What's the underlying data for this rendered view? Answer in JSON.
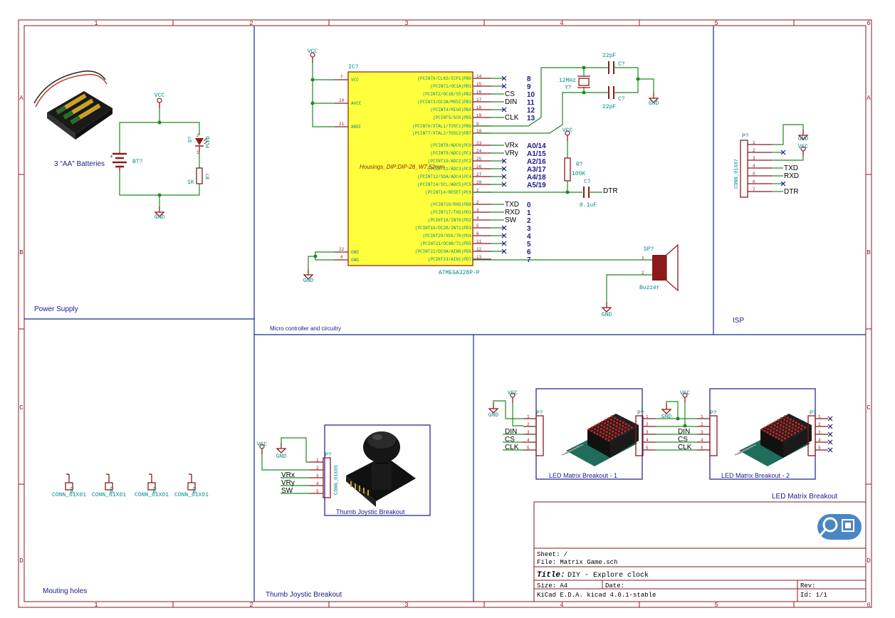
{
  "frame": {
    "cols": [
      "1",
      "2",
      "3",
      "4",
      "5",
      "6"
    ],
    "rows": [
      "A",
      "B",
      "C",
      "D"
    ]
  },
  "power_supply": {
    "title": "Power Supply",
    "battery_label": "3 \"AA\" Batteries",
    "battery_ref": "BT?",
    "vcc": "VCC",
    "gnd": "GND",
    "led_ref": "D?",
    "led_value": "PLED",
    "res_ref": "R?",
    "res_value": "1K",
    "pin1": "1",
    "pin2": "2"
  },
  "mcu": {
    "section_title": "Micro controller and circuitry",
    "ref": "IC?",
    "value": "ATMEGA328P-P",
    "footprint": "Housings_DIP:DIP-28_W7.62mm",
    "vcc": "VCC",
    "gnd": "GND",
    "left_pins": [
      {
        "num": "7",
        "name": "VCC"
      },
      {
        "num": "20",
        "name": "AVCC"
      },
      {
        "num": "21",
        "name": "AREF"
      },
      {
        "num": "22",
        "name": "GND"
      },
      {
        "num": "8",
        "name": "GND"
      }
    ],
    "right_pins": [
      {
        "num": "14",
        "name": "(PCINT0/CLKO/ICP1)PB0",
        "net": "",
        "arduino": "8",
        "nc": true
      },
      {
        "num": "15",
        "name": "(PCINT1/OC1A)PB1",
        "net": "",
        "arduino": "9",
        "nc": true
      },
      {
        "num": "16",
        "name": "(PCINT2/OC1B/SS)PB2",
        "net": "CS",
        "arduino": "10",
        "nc": false
      },
      {
        "num": "17",
        "name": "(PCINT3/OC2A/MOSI)PB3",
        "net": "DIN",
        "arduino": "11",
        "nc": false
      },
      {
        "num": "18",
        "name": "(PCINT4/MISO)PB4",
        "net": "",
        "arduino": "12",
        "nc": true
      },
      {
        "num": "19",
        "name": "(PCINT5/SCK)PB5",
        "net": "CLK",
        "arduino": "13",
        "nc": false
      },
      {
        "num": "9",
        "name": "(PCINT6/XTAL1/TOSC1)PB6",
        "net": "",
        "arduino": "",
        "nc": false
      },
      {
        "num": "10",
        "name": "(PCINT7/XTAL2/TOSC2)PB7",
        "net": "",
        "arduino": "",
        "nc": false
      },
      {
        "num": "23",
        "name": "(PCINT8/ADC0)PC0",
        "net": "VRx",
        "arduino": "A0/14",
        "nc": false
      },
      {
        "num": "24",
        "name": "(PCINT9/ADC1)PC1",
        "net": "VRy",
        "arduino": "A1/15",
        "nc": false
      },
      {
        "num": "25",
        "name": "(PCINT10/ADC2)PC2",
        "net": "",
        "arduino": "A2/16",
        "nc": true
      },
      {
        "num": "26",
        "name": "(PCINT11/ADC3)PC3",
        "net": "",
        "arduino": "A3/17",
        "nc": true
      },
      {
        "num": "27",
        "name": "(PCINT12/SDA/ADC4)PC4",
        "net": "",
        "arduino": "A4/18",
        "nc": true
      },
      {
        "num": "28",
        "name": "(PCINT14/SCL/ADC5)PC5",
        "net": "",
        "arduino": "A5/19",
        "nc": true
      },
      {
        "num": "1",
        "name": "(PCINT14/RESET)PC6",
        "net": "",
        "arduino": "",
        "nc": false
      },
      {
        "num": "2",
        "name": "(PCINT16/RXD)PD0",
        "net": "TXD",
        "arduino": "0",
        "nc": false
      },
      {
        "num": "3",
        "name": "(PCINT17/TXD)PD1",
        "net": "RXD",
        "arduino": "1",
        "nc": false
      },
      {
        "num": "4",
        "name": "(PCINT18/INT0)PD2",
        "net": "SW",
        "arduino": "2",
        "nc": false
      },
      {
        "num": "5",
        "name": "(PCINT19/OC2B/INT1)PD3",
        "net": "",
        "arduino": "3",
        "nc": true
      },
      {
        "num": "6",
        "name": "(PCINT20/XCK/T0)PD4",
        "net": "",
        "arduino": "4",
        "nc": true
      },
      {
        "num": "11",
        "name": "(PCINT21/OC0B/T1)PD5",
        "net": "",
        "arduino": "5",
        "nc": true
      },
      {
        "num": "12",
        "name": "(PCINT22/OC0A/AIN0)PD6",
        "net": "",
        "arduino": "6",
        "nc": true
      },
      {
        "num": "13",
        "name": "(PCINT23/AIN1)PD7",
        "net": "",
        "arduino": "7",
        "nc": false
      }
    ],
    "crystal_value": "12MHz",
    "crystal_ref": "Y?",
    "cap1_value": "22pF",
    "cap1_ref": "C?",
    "cap2_value": "22pF",
    "cap2_ref": "C?",
    "pullup_ref": "R?",
    "pullup_value": "100K",
    "reset_cap_ref": "C?",
    "reset_cap_value": "0.1uF",
    "dtr": "DTR",
    "buzzer_ref": "SP?",
    "buzzer_value": "Buzzer",
    "buzzer_pin1": "1",
    "buzzer_pin2": "2"
  },
  "isp": {
    "title": "ISP",
    "ref": "P?",
    "value": "CONN_01X07",
    "gnd": "GND",
    "vcc": "VCC",
    "pins": [
      "1",
      "2",
      "3",
      "4",
      "5",
      "6",
      "7"
    ],
    "nets": [
      "",
      "",
      "",
      "TXD",
      "RXD",
      "",
      "DTR"
    ]
  },
  "mounting": {
    "title": "Mouting holes",
    "holes": [
      {
        "ref": "P?",
        "value": "CONN_01X01"
      },
      {
        "ref": "P?",
        "value": "CONN_01X01"
      },
      {
        "ref": "P?",
        "value": "CONN_01X01"
      },
      {
        "ref": "P?",
        "value": "CONN_01X01"
      }
    ]
  },
  "joystick": {
    "title": "Thumb Joystic Breakout",
    "image_caption": "Thumb Joystic Breakout",
    "ref": "P?",
    "value": "CONN_01X05",
    "vcc": "VCC",
    "gnd": "GND",
    "pins": [
      "1",
      "2",
      "3",
      "4",
      "5"
    ],
    "nets": [
      "",
      "",
      "VRx",
      "VRy",
      "SW"
    ]
  },
  "matrix": {
    "title": "LED Matrix Breakout",
    "module1_caption": "LED Matrix Breakout - 1",
    "module2_caption": "LED Matrix Breakout - 2",
    "vcc": "VCC",
    "gnd": "GND",
    "ref": "P?",
    "pins": [
      "1",
      "2",
      "3",
      "4",
      "5"
    ],
    "nets": [
      "",
      "",
      "DIN",
      "CS",
      "CLK"
    ]
  },
  "title_block": {
    "sheet": "Sheet: /",
    "file": "File: Matrix Game.sch",
    "title_label": "Title:",
    "title": "DIY - Explore clock",
    "size": "Size: A4",
    "date": "Date:",
    "rev": "Rev:",
    "tool": "KiCad E.D.A.  kicad 4.0.1-stable",
    "id": "Id: 1/1"
  },
  "colors": {
    "frame": "#8b1a1a",
    "wire": "#1e8a1e",
    "ic_fill": "#ffff3c",
    "label_blue": "#1a1a8b",
    "label_teal": "#008b8b"
  }
}
